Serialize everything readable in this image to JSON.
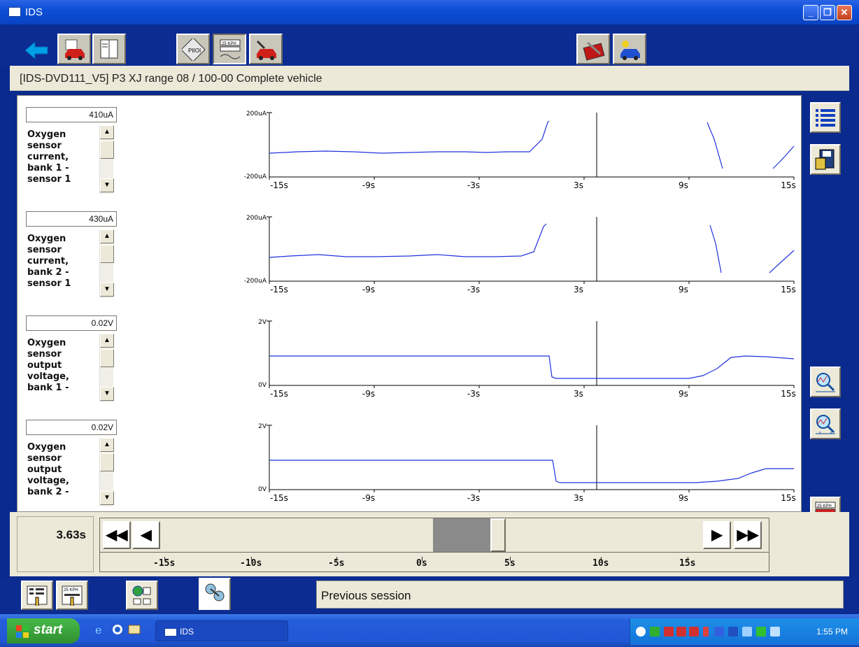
{
  "window": {
    "title": "IDS"
  },
  "header": {
    "text": "[IDS-DVD111_V5] P3   XJ range 08 / 100-00 Complete vehicle"
  },
  "pids": [
    {
      "value": "410uA",
      "label": "Oxygen sensor current, bank 1 - sensor 1",
      "ymax": "200uA",
      "ymin": "-200uA"
    },
    {
      "value": "430uA",
      "label": "Oxygen sensor current, bank 2 - sensor 1",
      "ymax": "200uA",
      "ymin": "-200uA"
    },
    {
      "value": "0.02V",
      "label": "Oxygen sensor output voltage, bank 1 -",
      "ymax": "2V",
      "ymin": "0V"
    },
    {
      "value": "0.02V",
      "label": "Oxygen sensor output voltage, bank 2 -",
      "ymax": "2V",
      "ymin": "0V"
    }
  ],
  "plot_xticks": [
    "-15s",
    "-9s",
    "-3s",
    "3s",
    "9s",
    "15s"
  ],
  "cursor_time": "3.63s",
  "timeline_ticks": [
    "-15s",
    "-10s",
    "-5s",
    "0s",
    "5s",
    "10s",
    "15s"
  ],
  "status": "Previous session",
  "taskbar": {
    "start": "start",
    "task": "IDS",
    "clock": "1:55 PM"
  },
  "colors": {
    "trace": "#2233dd",
    "titlebar": "#0b4fd8",
    "toolbar": "#0c2c92"
  }
}
